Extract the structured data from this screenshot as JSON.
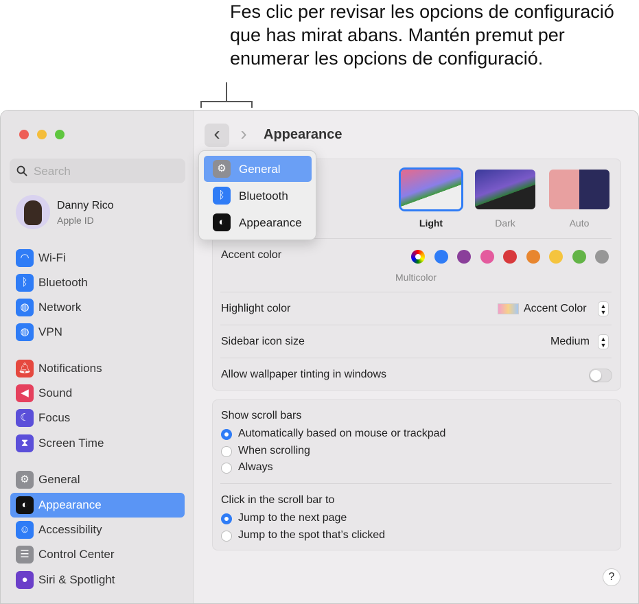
{
  "callout": {
    "text": "Fes clic per revisar les opcions de configuració que has mirat abans. Mantén premut per enumerar les opcions de configuració."
  },
  "sidebar": {
    "search_placeholder": "Search",
    "account": {
      "name": "Danny Rico",
      "subtitle": "Apple ID"
    },
    "items": [
      {
        "label": "Wi-Fi",
        "icon": "wifi-icon",
        "color": "#2f7cf6"
      },
      {
        "label": "Bluetooth",
        "icon": "bluetooth-icon",
        "color": "#2f7cf6"
      },
      {
        "label": "Network",
        "icon": "globe-icon",
        "color": "#2f7cf6"
      },
      {
        "label": "VPN",
        "icon": "vpn-globe-icon",
        "color": "#2f7cf6"
      },
      {
        "label": "Notifications",
        "icon": "bell-icon",
        "color": "#e5483f"
      },
      {
        "label": "Sound",
        "icon": "speaker-icon",
        "color": "#e5405d"
      },
      {
        "label": "Focus",
        "icon": "moon-icon",
        "color": "#5b4fd9"
      },
      {
        "label": "Screen Time",
        "icon": "hourglass-icon",
        "color": "#5b4fd9"
      },
      {
        "label": "General",
        "icon": "gear-icon",
        "color": "#8e8e93"
      },
      {
        "label": "Appearance",
        "icon": "appearance-icon",
        "color": "#111111",
        "selected": true
      },
      {
        "label": "Accessibility",
        "icon": "accessibility-icon",
        "color": "#2f7cf6"
      },
      {
        "label": "Control Center",
        "icon": "control-center-icon",
        "color": "#8e8e93"
      },
      {
        "label": "Siri & Spotlight",
        "icon": "siri-icon",
        "color": "#6b3fc9"
      }
    ]
  },
  "toolbar": {
    "title": "Appearance",
    "back": "‹",
    "forward": "›"
  },
  "history_menu": {
    "items": [
      {
        "label": "General",
        "icon": "gear-icon",
        "selected": true
      },
      {
        "label": "Bluetooth",
        "icon": "bluetooth-icon"
      },
      {
        "label": "Appearance",
        "icon": "appearance-icon"
      }
    ]
  },
  "appearance": {
    "options": [
      {
        "label": "Light",
        "selected": true
      },
      {
        "label": "Dark"
      },
      {
        "label": "Auto"
      }
    ]
  },
  "accent": {
    "label": "Accent color",
    "selected_label": "Multicolor",
    "colors": [
      "multicolor",
      "#2f7cf6",
      "#8a3f9a",
      "#e45b9e",
      "#d8393c",
      "#e8862f",
      "#f5c43e",
      "#63b447",
      "#979797"
    ]
  },
  "highlight": {
    "label": "Highlight color",
    "value": "Accent Color"
  },
  "sidebar_icon_size": {
    "label": "Sidebar icon size",
    "value": "Medium"
  },
  "wallpaper_tinting": {
    "label": "Allow wallpaper tinting in windows",
    "on": false
  },
  "scroll_bars": {
    "label": "Show scroll bars",
    "options": [
      {
        "label": "Automatically based on mouse or trackpad",
        "selected": true
      },
      {
        "label": "When scrolling"
      },
      {
        "label": "Always"
      }
    ]
  },
  "click_scroll": {
    "label": "Click in the scroll bar to",
    "options": [
      {
        "label": "Jump to the next page",
        "selected": true
      },
      {
        "label": "Jump to the spot that’s clicked"
      }
    ]
  },
  "help": "?"
}
